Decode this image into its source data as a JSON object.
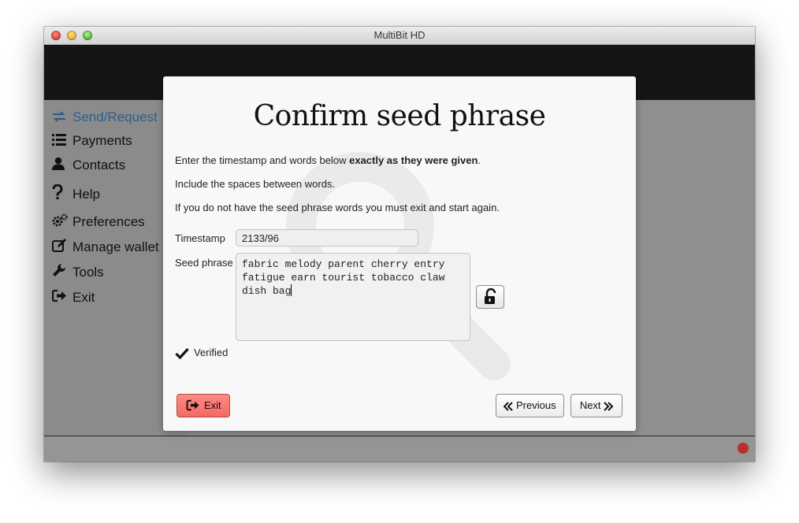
{
  "window": {
    "title": "MultiBit HD"
  },
  "sidebar": {
    "items": [
      {
        "label": "Send/Request",
        "icon": "exchange-icon"
      },
      {
        "label": "Payments",
        "icon": "list-icon"
      },
      {
        "label": "Contacts",
        "icon": "user-icon"
      },
      {
        "label": "Help",
        "icon": "question-icon"
      },
      {
        "label": "Preferences",
        "icon": "gears-icon"
      },
      {
        "label": "Manage wallet",
        "icon": "edit-icon"
      },
      {
        "label": "Tools",
        "icon": "wrench-icon"
      },
      {
        "label": "Exit",
        "icon": "sign-out-icon"
      }
    ]
  },
  "dialog": {
    "title": "Confirm seed phrase",
    "instructions": {
      "line1_prefix": "Enter the timestamp and words below ",
      "line1_bold": "exactly as they were given",
      "line1_suffix": ".",
      "line2": "Include the spaces between words.",
      "line3": "If you do not have the seed phrase words you must exit and start again."
    },
    "timestamp": {
      "label": "Timestamp",
      "value": "2133/96"
    },
    "seed_phrase": {
      "label": "Seed phrase",
      "value": "fabric melody parent cherry entry fatigue earn tourist tobacco claw dish bag"
    },
    "status": {
      "label": "Verified"
    },
    "buttons": {
      "exit": "Exit",
      "previous": "Previous",
      "next": "Next"
    }
  },
  "colors": {
    "accent_active": "#2f5e88",
    "exit_button": "#f46963",
    "status_dot": "#b8302a"
  }
}
